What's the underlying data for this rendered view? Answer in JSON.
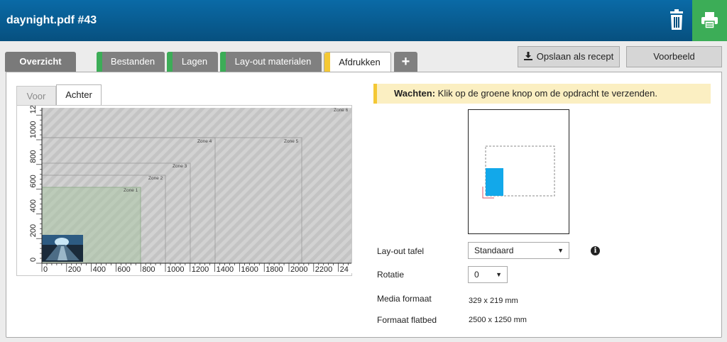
{
  "header": {
    "title": "daynight.pdf #43",
    "bg_color": "#07507f",
    "print_color": "#3cad57"
  },
  "tabs": [
    {
      "label": "Overzicht",
      "state": "inactive"
    },
    {
      "label": "Bestanden",
      "stripe": "#3cad57"
    },
    {
      "label": "Lagen",
      "stripe": "#3cad57"
    },
    {
      "label": "Lay-out materialen",
      "stripe": "#3cad57"
    },
    {
      "label": "Afdrukken",
      "stripe": "#f4c835",
      "state": "active"
    },
    {
      "label": "+",
      "icon": "plus-icon"
    }
  ],
  "toolbar": {
    "save_label": "Opslaan als recept",
    "save_icon": "download-icon",
    "preview_label": "Voorbeeld"
  },
  "subtabs": {
    "front_label": "Voor",
    "back_label": "Achter",
    "selected": "Achter"
  },
  "flatbed": {
    "x_ticks": [
      "0",
      "200",
      "400",
      "600",
      "800",
      "1000",
      "1200",
      "1400",
      "1600",
      "1800",
      "2000",
      "2200",
      "24"
    ],
    "y_ticks": [
      "0",
      "200",
      "400",
      "600",
      "800",
      "1000",
      "1200"
    ],
    "zones": [
      "Zone 6",
      "Zone 4",
      "Zone 5",
      "Zone 3",
      "Zone 2",
      "Zone 1"
    ]
  },
  "notice": {
    "strong": "Wachten:",
    "text": "Klik op de groene knop om de opdracht te verzenden."
  },
  "settings": {
    "layout_table_label": "Lay-out tafel",
    "layout_table_value": "Standaard",
    "rotation_label": "Rotatie",
    "rotation_value": "0",
    "media_format_label": "Media formaat",
    "media_format_value": "329 x 219 mm",
    "flatbed_format_label": "Formaat flatbed",
    "flatbed_format_value": "2500 x 1250 mm"
  }
}
